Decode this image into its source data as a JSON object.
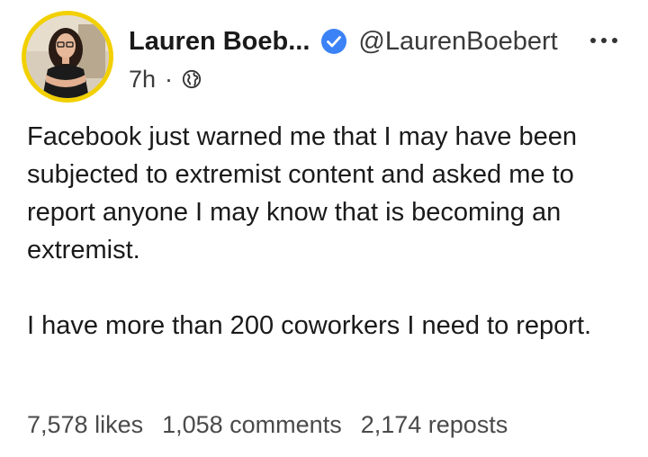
{
  "post": {
    "author": {
      "display_name": "Lauren Boeb...",
      "handle": "@LaurenBoebert",
      "verified": true,
      "avatar_ring_color": "#f2d000"
    },
    "timestamp": "7h",
    "meta_separator": "·",
    "visibility_icon": "globe-icon",
    "more_icon": "more-horizontal-icon",
    "verified_color": "#3b82f6",
    "body": [
      "Facebook just warned me that I may have been subjected to extremist content and asked me to report anyone I may know that is becoming an extremist.",
      "I have more than 200 coworkers I need to report."
    ],
    "stats": {
      "likes": "7,578 likes",
      "comments": "1,058 comments",
      "reposts": "2,174 reposts"
    }
  }
}
